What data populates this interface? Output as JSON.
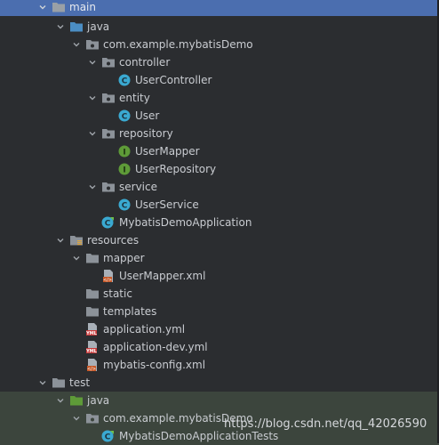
{
  "tree": {
    "main": "main",
    "java": "java",
    "package": "com.example.mybatisDemo",
    "controller": "controller",
    "user_controller": "UserController",
    "entity": "entity",
    "user": "User",
    "repository": "repository",
    "user_mapper": "UserMapper",
    "user_repository": "UserRepository",
    "service": "service",
    "user_service": "UserService",
    "app": "MybatisDemoApplication",
    "resources": "resources",
    "mapper": "mapper",
    "user_mapper_xml": "UserMapper.xml",
    "static": "static",
    "templates": "templates",
    "app_yml": "application.yml",
    "app_dev_yml": "application-dev.yml",
    "mybatis_config": "mybatis-config.xml",
    "test": "test",
    "test_java": "java",
    "test_package": "com.example.mybatisDemo",
    "tests_class": "MybatisDemoApplicationTests"
  },
  "watermark": "https://blog.csdn.net/qq_42026590",
  "icons": {
    "class": "class-icon",
    "interface": "interface-icon",
    "folder": "folder-icon",
    "source-folder": "source-folder-icon",
    "resources-folder": "resources-folder-icon",
    "xml": "xml-file-icon",
    "yml": "yml-file-icon",
    "spring-app": "spring-boot-class-icon",
    "chevron": "chevron-down-icon"
  },
  "colors": {
    "background": "#2b2d30",
    "selection": "#4b6eaf",
    "test_band": "#3c453d",
    "class_icon": "#3aa9d1",
    "interface_icon": "#5e9b38",
    "folder": "#8c9299",
    "source_folder": "#4b8ec4"
  }
}
